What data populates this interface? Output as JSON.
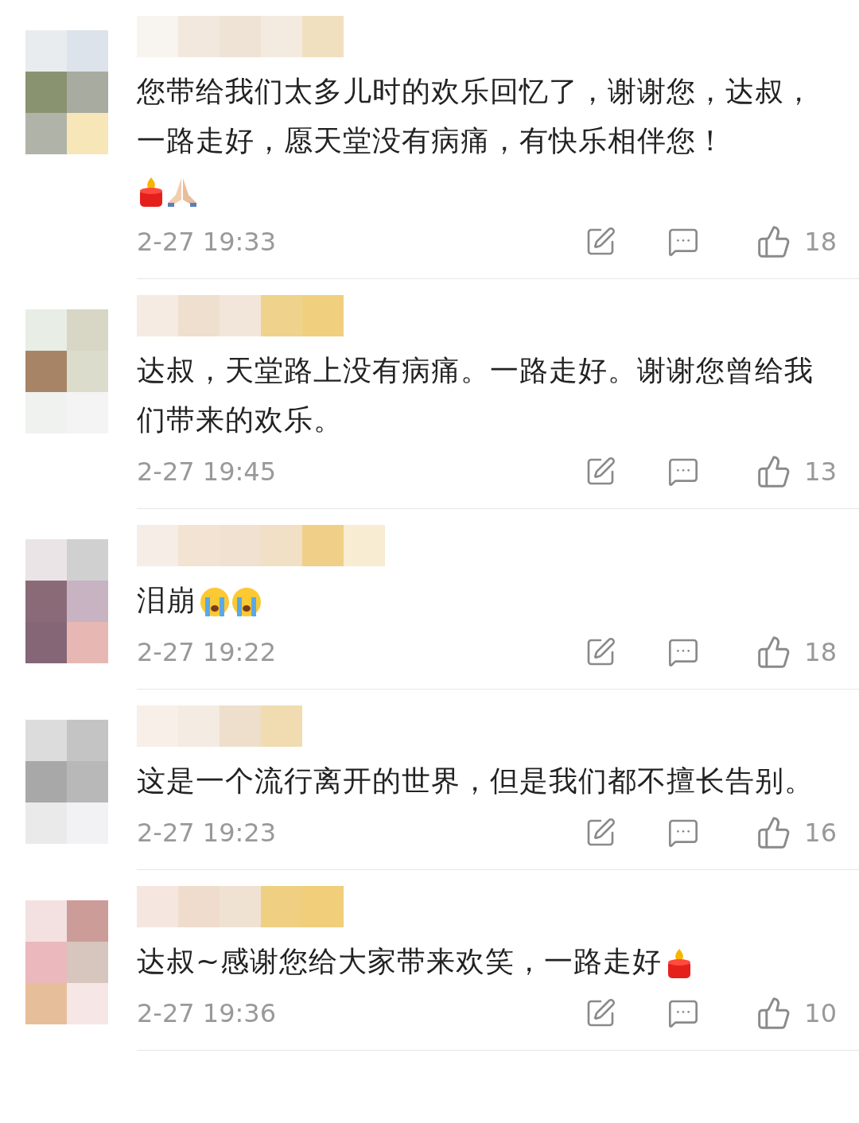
{
  "comments": [
    {
      "text": "您带给我们太多儿时的欢乐回忆了，谢谢您，达叔，一路走好，愿天堂没有病痛，有快乐相伴您！",
      "emoji": [
        {
          "kind": "candle"
        },
        {
          "kind": "pray"
        }
      ],
      "time": "2-27 19:33",
      "likes": "18"
    },
    {
      "text": "达叔，天堂路上没有病痛。一路走好。谢谢您曾给我们带来的欢乐。",
      "time": "2-27 19:45",
      "likes": "13"
    },
    {
      "text": "泪崩",
      "emoji": [
        {
          "kind": "cry"
        },
        {
          "kind": "cry"
        }
      ],
      "time": "2-27 19:22",
      "likes": "18"
    },
    {
      "text": "这是一个流行离开的世界，但是我们都不擅长告别。",
      "time": "2-27 19:23",
      "likes": "16"
    },
    {
      "text": "达叔~感谢您给大家带来欢笑，一路走好",
      "emoji": [
        {
          "kind": "candle"
        }
      ],
      "time": "2-27 19:36",
      "likes": "10"
    }
  ]
}
